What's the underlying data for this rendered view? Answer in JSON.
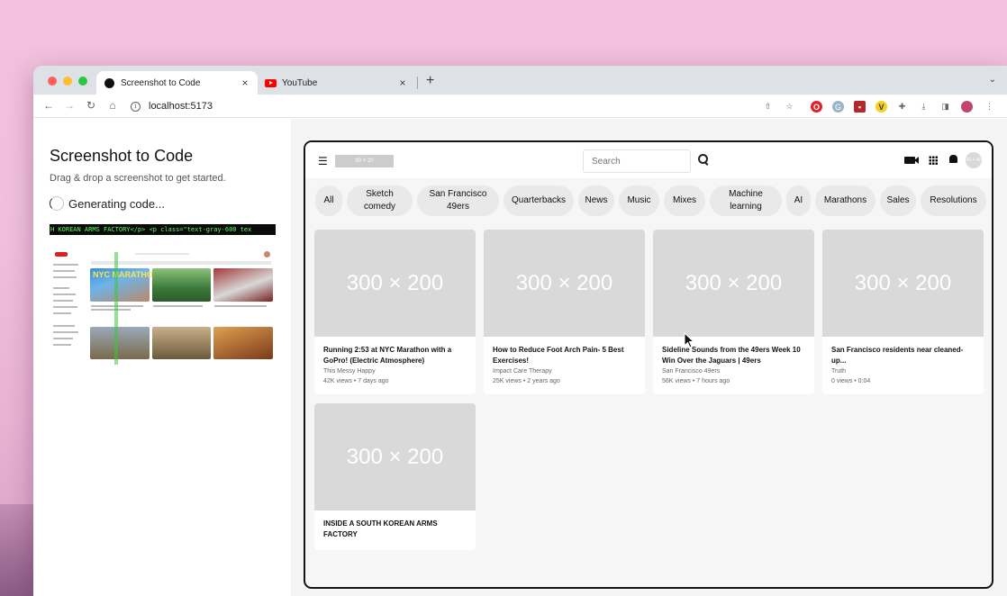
{
  "browser": {
    "tabs": [
      {
        "title": "Screenshot to Code",
        "close": "×",
        "active": true
      },
      {
        "title": "YouTube",
        "close": "×",
        "active": false
      }
    ],
    "new_tab": "+",
    "tab_menu": "⌄",
    "url": "localhost:5173",
    "nav": {
      "back": "←",
      "forward": "→",
      "reload": "↻",
      "home": "⌂"
    },
    "extensions": [
      "share-icon",
      "star-icon",
      "opera-icon",
      "grammarly-icon",
      "bookmark-ext-icon",
      "v-ext-icon",
      "puzzle-icon",
      "download-icon",
      "sidepanel-icon",
      "profile-icon",
      "kebab-icon"
    ]
  },
  "app": {
    "title": "Screenshot to Code",
    "subtitle": "Drag & drop a screenshot to get started.",
    "status": "Generating code...",
    "code_stream": "H KOREAN ARMS FACTORY</p> <p class=\"text-gray-600 tex",
    "thumbnail": {
      "nyc_banner": "NYC MARATHON"
    }
  },
  "preview": {
    "logo_placeholder": "90 × 20",
    "search_placeholder": "Search",
    "avatar_placeholder": "40 × 40",
    "chips": [
      "All",
      "Sketch comedy",
      "San Francisco 49ers",
      "Quarterbacks",
      "News",
      "Music",
      "Mixes",
      "Machine learning",
      "AI",
      "Marathons",
      "Sales",
      "Resolutions"
    ],
    "videos": [
      {
        "thumb": "300 × 200",
        "title": "Running 2:53 at NYC Marathon with a GoPro! (Electric Atmosphere)",
        "channel": "This Messy Happy",
        "meta": "42K views • 7 days ago"
      },
      {
        "thumb": "300 × 200",
        "title": "How to Reduce Foot Arch Pain- 5 Best Exercises!",
        "channel": "Impact Care Therapy",
        "meta": "25K views • 2 years ago"
      },
      {
        "thumb": "300 × 200",
        "title": "Sideline Sounds from the 49ers Week 10 Win Over the Jaguars | 49ers",
        "channel": "San Francisco 49ers",
        "meta": "56K views • 7 hours ago"
      },
      {
        "thumb": "300 × 200",
        "title": "San Francisco residents near cleaned-up...",
        "channel": "Truth",
        "meta": "0 views • 0:04"
      },
      {
        "thumb": "300 × 200",
        "title": "INSIDE A SOUTH KOREAN ARMS FACTORY",
        "channel": "",
        "meta": ""
      }
    ]
  },
  "colors": {
    "desktop": "#f2c2de",
    "tabbar": "#dee1e6",
    "placeholder": "#d9d9d9",
    "code_text": "#5eff5e"
  }
}
